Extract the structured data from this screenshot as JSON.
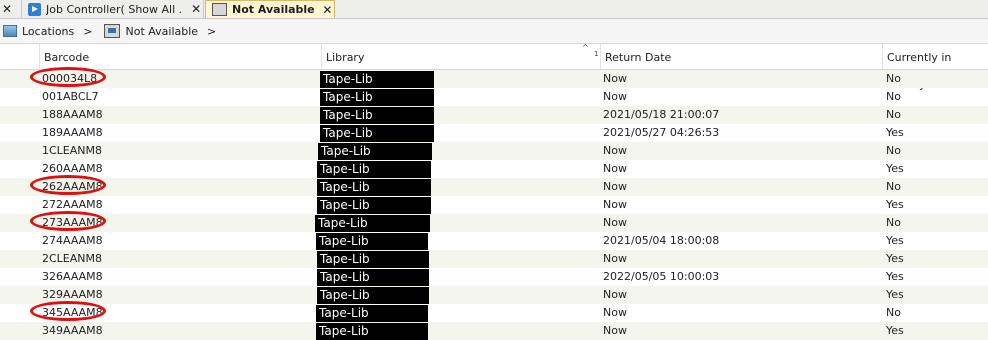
{
  "tabs": [
    {
      "label": "Job Controller( Show All ..."
    },
    {
      "label": "Not Available"
    }
  ],
  "breadcrumb": {
    "root": "Locations",
    "current": "Not Available",
    "separator": ">"
  },
  "columns": {
    "barcode": "Barcode",
    "library": "Library",
    "return_date": "Return Date",
    "in_library": "Currently in Library",
    "sort_index": "1"
  },
  "rows": [
    {
      "barcode": "000034L8",
      "library": "Tape-Lib",
      "return_date": "Now",
      "in_library": "No",
      "circled": true
    },
    {
      "barcode": "001ABCL7",
      "library": "Tape-Lib",
      "return_date": "Now",
      "in_library": "No",
      "circled": false
    },
    {
      "barcode": "188AAAM8",
      "library": "Tape-Lib",
      "return_date": "2021/05/18 21:00:07",
      "in_library": "No",
      "circled": false
    },
    {
      "barcode": "189AAAM8",
      "library": "Tape-Lib",
      "return_date": "2021/05/27 04:26:53",
      "in_library": "Yes",
      "circled": false
    },
    {
      "barcode": "1CLEANM8",
      "library": "Tape-Lib",
      "return_date": "Now",
      "in_library": "No",
      "circled": false
    },
    {
      "barcode": "260AAAM8",
      "library": "Tape-Lib",
      "return_date": "Now",
      "in_library": "Yes",
      "circled": false
    },
    {
      "barcode": "262AAAM8",
      "library": "Tape-Lib",
      "return_date": "Now",
      "in_library": "No",
      "circled": true
    },
    {
      "barcode": "272AAAM8",
      "library": "Tape-Lib",
      "return_date": "Now",
      "in_library": "Yes",
      "circled": false
    },
    {
      "barcode": "273AAAM8",
      "library": "Tape-Lib",
      "return_date": "Now",
      "in_library": "No",
      "circled": true
    },
    {
      "barcode": "274AAAM8",
      "library": "Tape-Lib",
      "return_date": "2021/05/04 18:00:08",
      "in_library": "Yes",
      "circled": false
    },
    {
      "barcode": "2CLEANM8",
      "library": "Tape-Lib",
      "return_date": "Now",
      "in_library": "Yes",
      "circled": false
    },
    {
      "barcode": "326AAAM8",
      "library": "Tape-Lib",
      "return_date": "2022/05/05 10:00:03",
      "in_library": "Yes",
      "circled": false
    },
    {
      "barcode": "329AAAM8",
      "library": "Tape-Lib",
      "return_date": "Now",
      "in_library": "Yes",
      "circled": false
    },
    {
      "barcode": "345AAAM8",
      "library": "Tape-Lib",
      "return_date": "Now",
      "in_library": "No",
      "circled": true
    },
    {
      "barcode": "349AAAM8",
      "library": "Tape-Lib",
      "return_date": "Now",
      "in_library": "Yes",
      "circled": false
    }
  ]
}
